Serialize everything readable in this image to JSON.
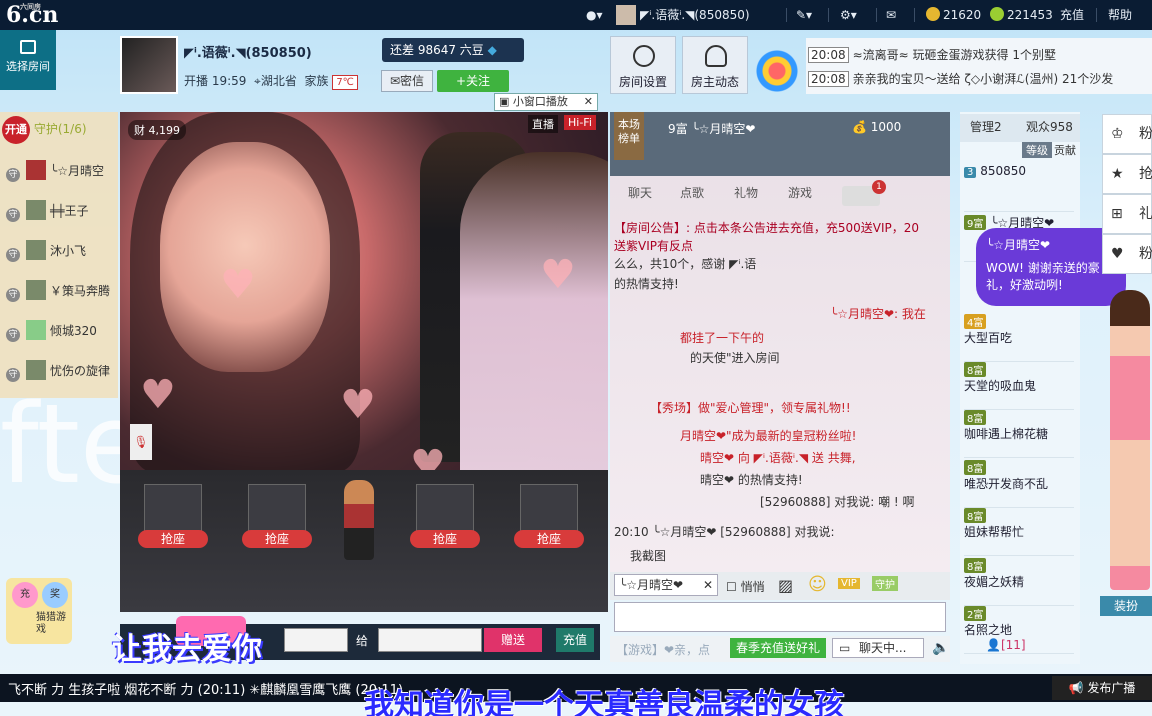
{
  "topbar": {
    "logo": "6.cn",
    "logo_sub": "六间房",
    "user_name": "◤ⁱ.语薇ⁱ.◥(850850)",
    "coins_gold": "21620",
    "coins_green": "221453",
    "recharge": "充值",
    "help": "帮助"
  },
  "left": {
    "select_room": "选择房间"
  },
  "anchor": {
    "name": "◤ⁱ.语薇ⁱ.◥(850850)",
    "diff_label": "还差 98647 六豆",
    "live": "开播 19:59",
    "location": "湖北省",
    "family": "家族",
    "family_tag": "7℃",
    "msg": "密信",
    "follow": "+关注",
    "mini_play": "小窗口播放"
  },
  "room_btns": {
    "settings": "房间设置",
    "owner": "房主动态"
  },
  "news": [
    {
      "time": "20:08",
      "text": "≈流离哥≈ 玩砸金蛋游戏获得 1个别墅"
    },
    {
      "time": "20:08",
      "text": "亲亲我的宝贝～送给 ζ◇小谢湃ℒ(温州) 21个沙发"
    }
  ],
  "guard": {
    "open": "开通",
    "title": "守护(1/6)",
    "members": [
      "╰☆月晴空",
      "╪╪王子",
      "沐小飞",
      "￥策马奔腾",
      "倾城320",
      "忧伤の旋律"
    ]
  },
  "video": {
    "viewers": "4,199",
    "direct": "直播",
    "hifi": "Hi-Fi"
  },
  "seats": [
    "抢座",
    "抢座",
    "抢座",
    "抢座"
  ],
  "gift": {
    "give": "给",
    "send": "赠送",
    "recharge": "充值"
  },
  "chat": {
    "rank_tag": "本场榜单",
    "top_user": "9富 ╰☆月晴空❤",
    "top_score": "1000",
    "tabs": [
      "聊天",
      "点歌",
      "礼物",
      "游戏",
      "1"
    ],
    "lines": [
      "【房间公告】: 点击本条公告进去充值，充500送VIP，20",
      "送紫VIP有反点",
      "么么，共10个，感谢 ◤ⁱ.语",
      "的热情支持!",
      "╰☆月晴空❤: 我在",
      "都挂了一下午的",
      "的天使\"进入房间",
      "【秀场】做\"爱心管理\"，领专属礼物!!",
      "月晴空❤\"成为最新的皇冠粉丝啦!",
      "晴空❤ 向 ◤ⁱ.语薇ⁱ.◥ 送 共舞,",
      "晴空❤ 的热情支持!",
      "[52960888] 对我说: 嘲 ! 啊",
      "20:10 ╰☆月晴空❤ [52960888] 对我说:",
      "我截图"
    ],
    "target": "╰☆月晴空❤",
    "quiet": "悄悄",
    "spring": "春季充值送好礼",
    "chatting": "聊天中...",
    "game_tag": "【游戏】❤亲，点",
    "online": "[11]"
  },
  "audience": {
    "tab_manage": "管理2",
    "tab_viewers": "观众958",
    "rank": "等级",
    "contrib": "贡献",
    "rows": [
      {
        "lv": "3",
        "name": "850850"
      },
      {
        "lv": "9富",
        "name": "╰☆月晴空❤"
      },
      {
        "lv": "4富",
        "name": "大型百吃"
      },
      {
        "lv": "8富",
        "name": "天堂的吸血鬼"
      },
      {
        "lv": "8富",
        "name": "咖啡遇上棉花糖"
      },
      {
        "lv": "8富",
        "name": "唯恐开发商不乱"
      },
      {
        "lv": "8富",
        "name": "姐妹帮帮忙"
      },
      {
        "lv": "8富",
        "name": "夜媚之妖精"
      },
      {
        "lv": "2富",
        "name": "名照之地"
      }
    ]
  },
  "bubble": {
    "user": "╰☆月晴空❤",
    "text": "WOW! 谢谢亲送的豪礼，好激动咧!"
  },
  "side": [
    "粉",
    "抢",
    "礼",
    "粉"
  ],
  "install": "装扮",
  "ticker": "飞不断 力 生孩子啦 烟花不断 力 (20:11)  ✳麒麟凰雪鹰飞鹰 (20:11)",
  "broadcast": "发布广播",
  "subtitle_top": "让我去爱你",
  "subtitle_bottom": "我知道你是一个天真善良温柔的女孩",
  "mini_game": {
    "charge": "充",
    "prize": "奖",
    "game": "猫猎游戏"
  },
  "bg_text": "fte",
  "colors": {
    "accent": "#c8222a",
    "green": "#3fb33f",
    "dark": "#0a1c33"
  }
}
